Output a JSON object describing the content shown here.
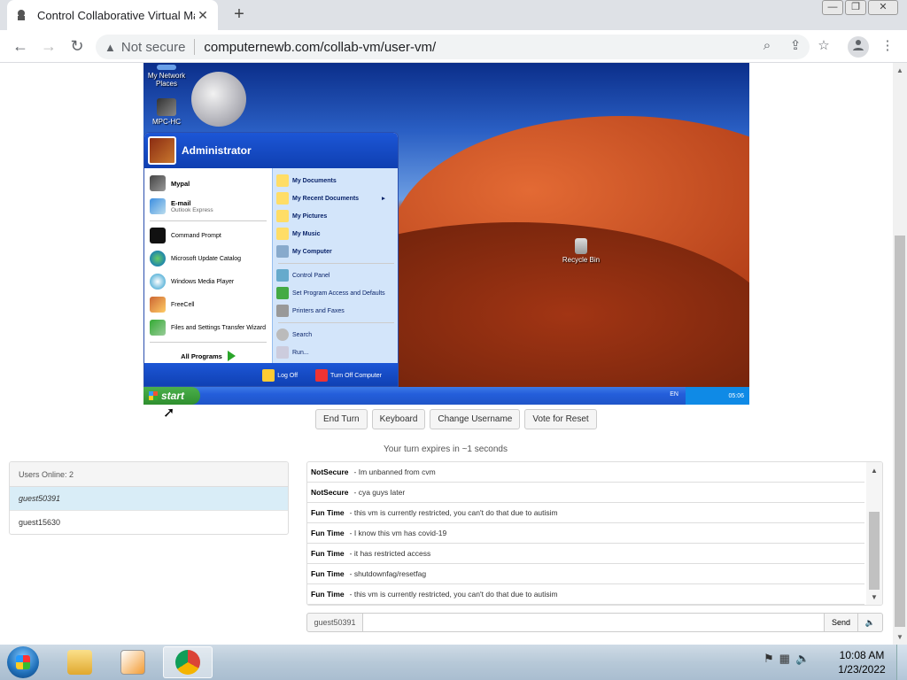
{
  "browser": {
    "tab_title": "Control Collaborative Virtual Mac",
    "tab_close": "✕",
    "new_tab": "+",
    "security_label": "Not secure",
    "url": "computernewb.com/collab-vm/user-vm/",
    "window_controls": [
      "—",
      "❐",
      "✕"
    ]
  },
  "vm": {
    "desktop_icons": [
      {
        "label": "My Network Places"
      },
      {
        "label": "MPC-HC"
      },
      {
        "label": "Recycle Bin"
      }
    ],
    "start_menu": {
      "user": "Administrator",
      "left_items": [
        {
          "label": "Mypal",
          "bold": true
        },
        {
          "label": "E-mail",
          "sub": "Outlook Express"
        },
        {
          "label": "Command Prompt"
        },
        {
          "label": "Microsoft Update Catalog"
        },
        {
          "label": "Windows Media Player"
        },
        {
          "label": "FreeCell"
        },
        {
          "label": "Files and Settings Transfer Wizard"
        }
      ],
      "all_programs": "All Programs",
      "right_items": [
        {
          "label": "My Documents"
        },
        {
          "label": "My Recent Documents",
          "arrow": "▸"
        },
        {
          "label": "My Pictures"
        },
        {
          "label": "My Music"
        },
        {
          "label": "My Computer"
        },
        {
          "label": "Control Panel"
        },
        {
          "label": "Set Program Access and Defaults"
        },
        {
          "label": "Printers and Faxes"
        },
        {
          "label": "Search"
        },
        {
          "label": "Run..."
        }
      ],
      "log_off": "Log Off",
      "turn_off": "Turn Off Computer"
    },
    "taskbar": {
      "start_label": "start",
      "lang": "EN",
      "clock": "05:06"
    }
  },
  "controls": {
    "buttons": [
      "End Turn",
      "Keyboard",
      "Change Username",
      "Vote for Reset"
    ],
    "turn_status": "Your turn expires in ~1 seconds"
  },
  "users": {
    "header": "Users Online: 2",
    "list": [
      "guest50391",
      "guest15630"
    ],
    "selected_index": 0
  },
  "chat": {
    "messages": [
      {
        "user": "NotSecure",
        "text": "Im unbanned from cvm"
      },
      {
        "user": "NotSecure",
        "text": "cya guys later"
      },
      {
        "user": "Fun Time",
        "text": "this vm is currently restricted, you can't do that due to autisim"
      },
      {
        "user": "Fun Time",
        "text": "I know this vm has covid-19"
      },
      {
        "user": "Fun Time",
        "text": "it has restricted access"
      },
      {
        "user": "Fun Time",
        "text": "shutdownfag/resetfag"
      },
      {
        "user": "Fun Time",
        "text": "this vm is currently restricted, you can't do that due to autisim"
      }
    ],
    "username": "guest50391",
    "input_value": "",
    "send_label": "Send",
    "volume_icon": "🔈"
  },
  "os_taskbar": {
    "time": "10:08 AM",
    "date": "1/23/2022",
    "apps": [
      "file-explorer",
      "media-player",
      "chrome"
    ]
  }
}
